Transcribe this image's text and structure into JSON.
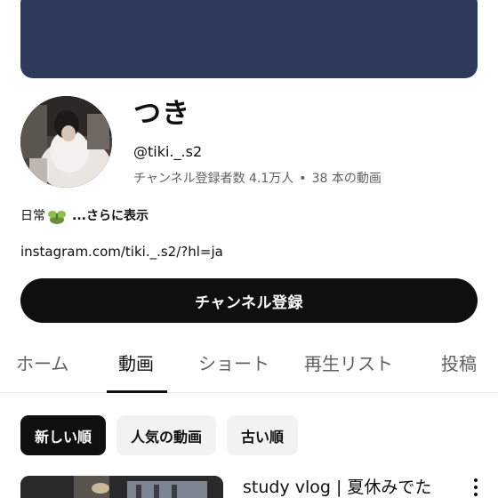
{
  "channel": {
    "name": "つき",
    "handle": "@tiki._.s2",
    "subscribers_label": "チャンネル登録者数 4.1万人",
    "separator": "•",
    "videos_label": "38 本の動画",
    "description_text": "日常",
    "description_emoji": "sprout-icon",
    "show_more": "...さらに表示",
    "link": "instagram.com/tiki._.s2/?hl=ja"
  },
  "subscribe_button": {
    "label": "チャンネル登録"
  },
  "tabs": [
    {
      "label": "ホーム",
      "active": false
    },
    {
      "label": "動画",
      "active": true
    },
    {
      "label": "ショート",
      "active": false
    },
    {
      "label": "再生リスト",
      "active": false
    },
    {
      "label": "投稿",
      "active": false
    }
  ],
  "chips": [
    {
      "label": "新しい順",
      "selected": true
    },
    {
      "label": "人気の動画",
      "selected": false
    },
    {
      "label": "古い順",
      "selected": false
    }
  ],
  "video": {
    "title": "study vlog | 夏休みでた"
  },
  "colors": {
    "banner": "#2d3a5c",
    "primary": "#0f0f0f",
    "secondary_text": "#606060",
    "chip_bg": "#f2f2f2"
  }
}
